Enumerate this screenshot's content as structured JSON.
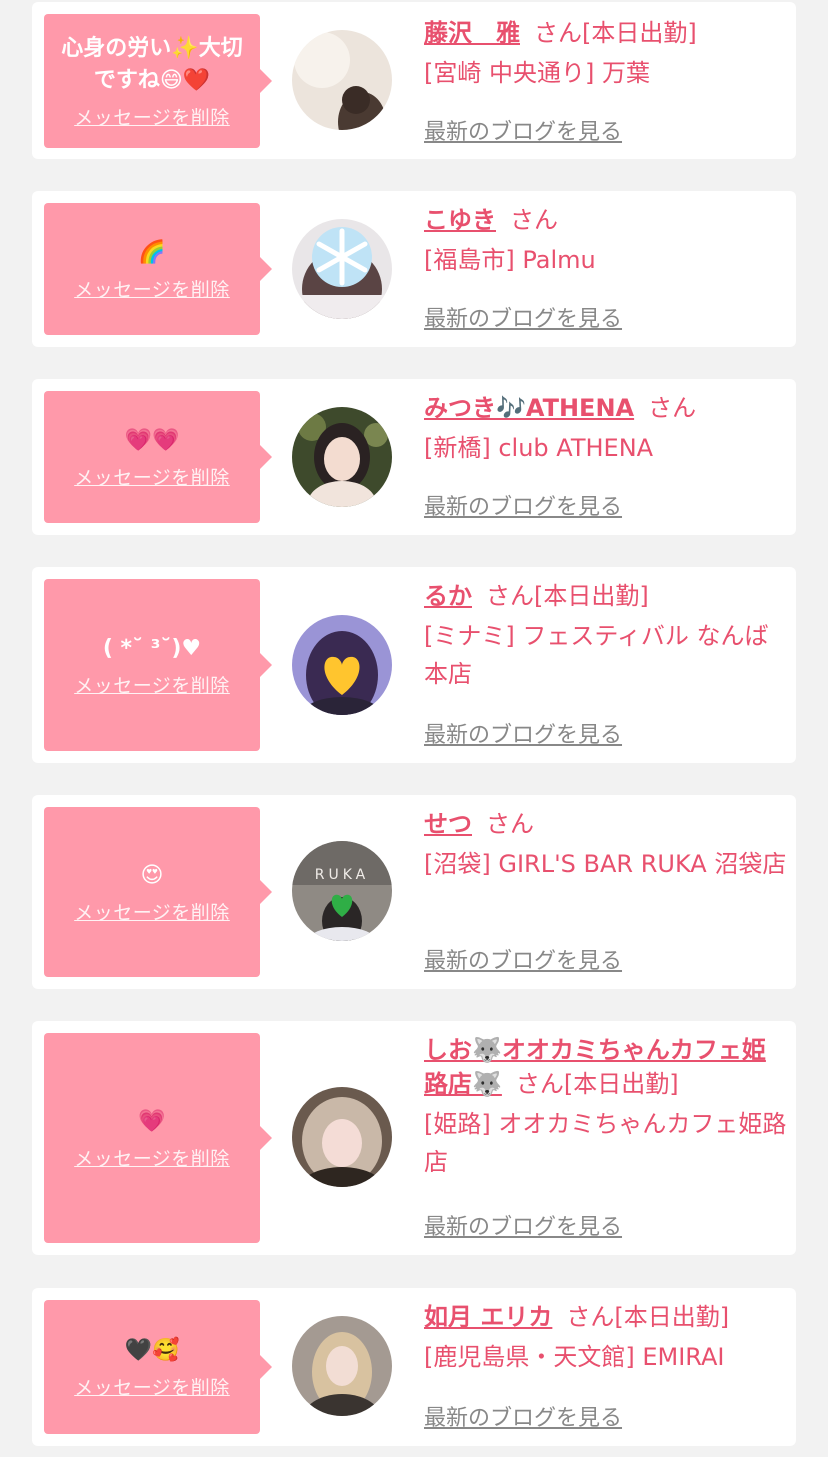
{
  "cards": [
    {
      "message": "心身の労い✨大切ですね😄❤️",
      "delete_label": "メッセージを削除",
      "name": "藤沢　雅",
      "honorific": "さん",
      "status": "[本日出勤]",
      "shop": "[宮崎 中央通り] 万葉",
      "blog_label": "最新のブログを見る"
    },
    {
      "message": "🌈",
      "delete_label": "メッセージを削除",
      "name": "こゆき",
      "honorific": "さん",
      "status": "",
      "shop": "[福島市] Palmu",
      "blog_label": "最新のブログを見る"
    },
    {
      "message": "💗💗",
      "delete_label": "メッセージを削除",
      "name": "みつき🎶ATHENA",
      "honorific": "さん",
      "status": "",
      "shop": "[新橋] club ATHENA",
      "blog_label": "最新のブログを見る"
    },
    {
      "message": "( *˘ ³˘)♥",
      "delete_label": "メッセージを削除",
      "name": "るか",
      "honorific": "さん",
      "status": "[本日出勤]",
      "shop": "[ミナミ] フェスティバル なんば本店",
      "blog_label": "最新のブログを見る"
    },
    {
      "message": "😍",
      "delete_label": "メッセージを削除",
      "name": "せつ",
      "honorific": "さん",
      "status": "",
      "shop": "[沼袋] GIRL'S BAR RUKA 沼袋店",
      "blog_label": "最新のブログを見る",
      "avatar_text": "RUKA"
    },
    {
      "message": "💗",
      "delete_label": "メッセージを削除",
      "name": "しお🐺オオカミちゃんカフェ姫路店🐺",
      "honorific": "さん",
      "status": "[本日出勤]",
      "shop": "[姫路] オオカミちゃんカフェ姫路店",
      "blog_label": "最新のブログを見る"
    },
    {
      "message": "🖤🥰",
      "delete_label": "メッセージを削除",
      "name": "如月 エリカ",
      "honorific": "さん",
      "status": "[本日出勤]",
      "shop": "[鹿児島県・天文館] EMIRAI",
      "blog_label": "最新のブログを見る"
    }
  ]
}
